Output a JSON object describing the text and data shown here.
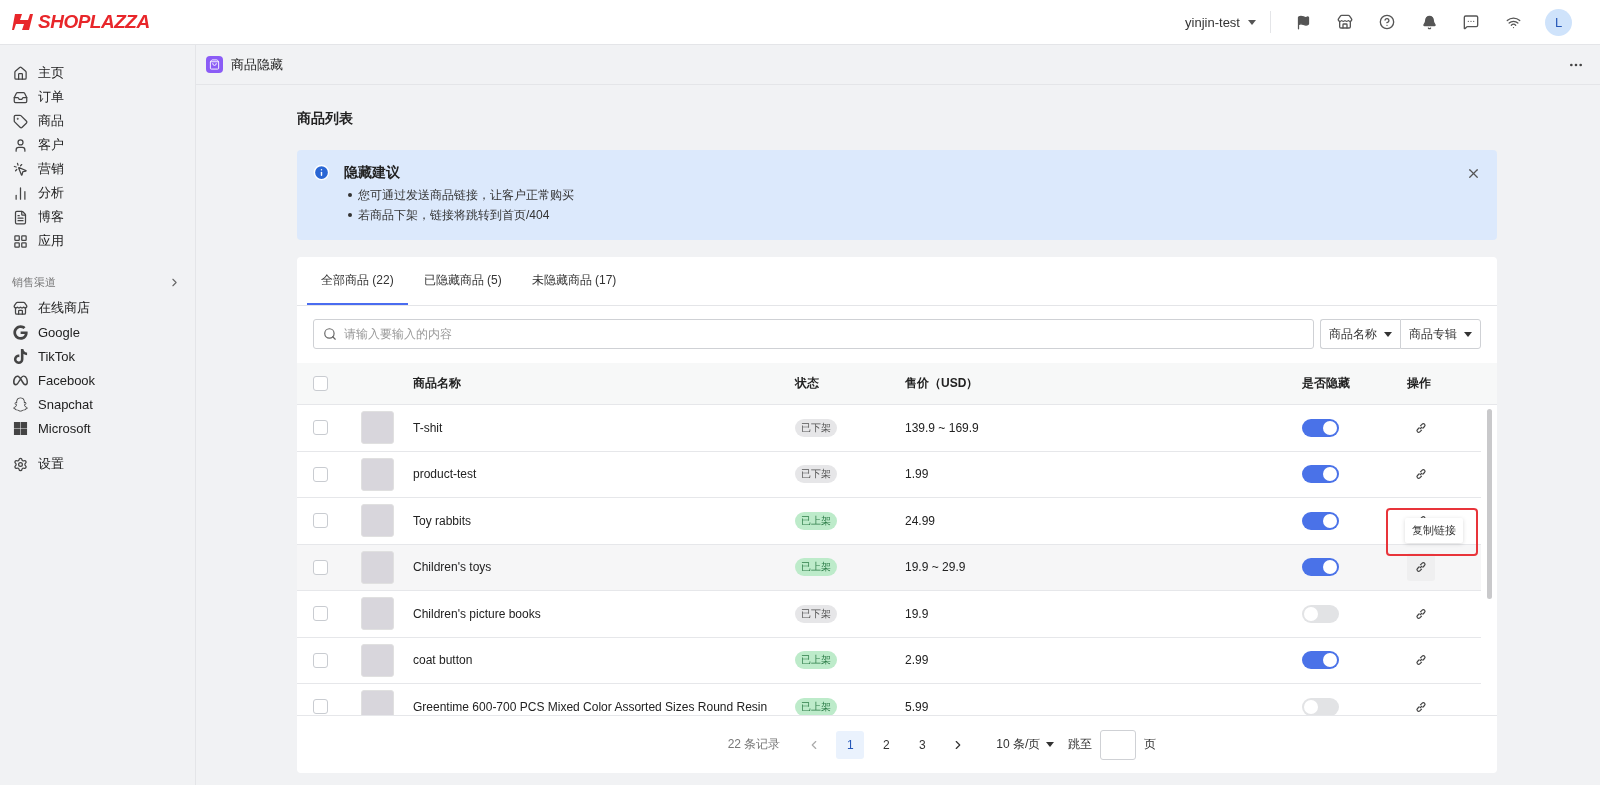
{
  "brand": {
    "name": "SHOPLAZZA"
  },
  "topbar": {
    "store": "yinjin-test",
    "avatar": "L"
  },
  "sidebar": {
    "items": [
      {
        "label": "主页",
        "selected": false
      },
      {
        "label": "订单",
        "selected": false
      },
      {
        "label": "商品",
        "selected": false
      },
      {
        "label": "客户",
        "selected": false
      },
      {
        "label": "营销",
        "selected": false
      },
      {
        "label": "分析",
        "selected": false
      },
      {
        "label": "博客",
        "selected": false
      },
      {
        "label": "应用",
        "selected": false
      }
    ],
    "channels_heading": "销售渠道",
    "channels": [
      {
        "label": "在线商店"
      },
      {
        "label": "Google"
      },
      {
        "label": "TikTok"
      },
      {
        "label": "Facebook"
      },
      {
        "label": "Snapchat"
      },
      {
        "label": "Microsoft"
      }
    ],
    "settings": "设置"
  },
  "app_bar": {
    "title": "商品隐藏"
  },
  "page_title": "商品列表",
  "notice": {
    "title": "隐藏建议",
    "items": [
      "您可通过发送商品链接，让客户正常购买",
      "若商品下架，链接将跳转到首页/404"
    ]
  },
  "tabs": [
    {
      "label": "全部商品 (22)",
      "selected": true
    },
    {
      "label": "已隐藏商品 (5)",
      "selected": false
    },
    {
      "label": "未隐藏商品 (17)",
      "selected": false
    }
  ],
  "search": {
    "placeholder": "请输入要输入的内容"
  },
  "filters": [
    "商品名称",
    "商品专辑"
  ],
  "table": {
    "select_all": false,
    "columns": [
      "商品名称",
      "状态",
      "售价（USD）",
      "是否隐藏",
      "操作"
    ],
    "rows": [
      {
        "name": "T-shit",
        "status": "已下架",
        "listed": false,
        "price": "139.9 ~ 169.9",
        "hidden": true,
        "checked": false,
        "hovered": false
      },
      {
        "name": "product-test",
        "status": "已下架",
        "listed": false,
        "price": "1.99",
        "hidden": true,
        "checked": false,
        "hovered": false
      },
      {
        "name": "Toy rabbits",
        "status": "已上架",
        "listed": true,
        "price": "24.99",
        "hidden": true,
        "checked": false,
        "hovered": false,
        "tooltip": "复制链接"
      },
      {
        "name": "Children's toys",
        "status": "已上架",
        "listed": true,
        "price": "19.9 ~ 29.9",
        "hidden": true,
        "checked": false,
        "hovered": true
      },
      {
        "name": "Children's picture books",
        "status": "已下架",
        "listed": false,
        "price": "19.9",
        "hidden": false,
        "checked": false,
        "hovered": false
      },
      {
        "name": "coat button",
        "status": "已上架",
        "listed": true,
        "price": "2.99",
        "hidden": true,
        "checked": false,
        "hovered": false
      },
      {
        "name": "Greentime 600-700 PCS Mixed Color Assorted Sizes Round Resin",
        "status": "已上架",
        "listed": true,
        "price": "5.99",
        "hidden": false,
        "checked": false,
        "hovered": false
      }
    ]
  },
  "pagination": {
    "total": "22 条记录",
    "pages": [
      {
        "label": "1",
        "selected": true
      },
      {
        "label": "2",
        "selected": false
      },
      {
        "label": "3",
        "selected": false
      }
    ],
    "page_size": "10 条/页",
    "jump_label": "跳至",
    "jump_suffix": "页"
  }
}
